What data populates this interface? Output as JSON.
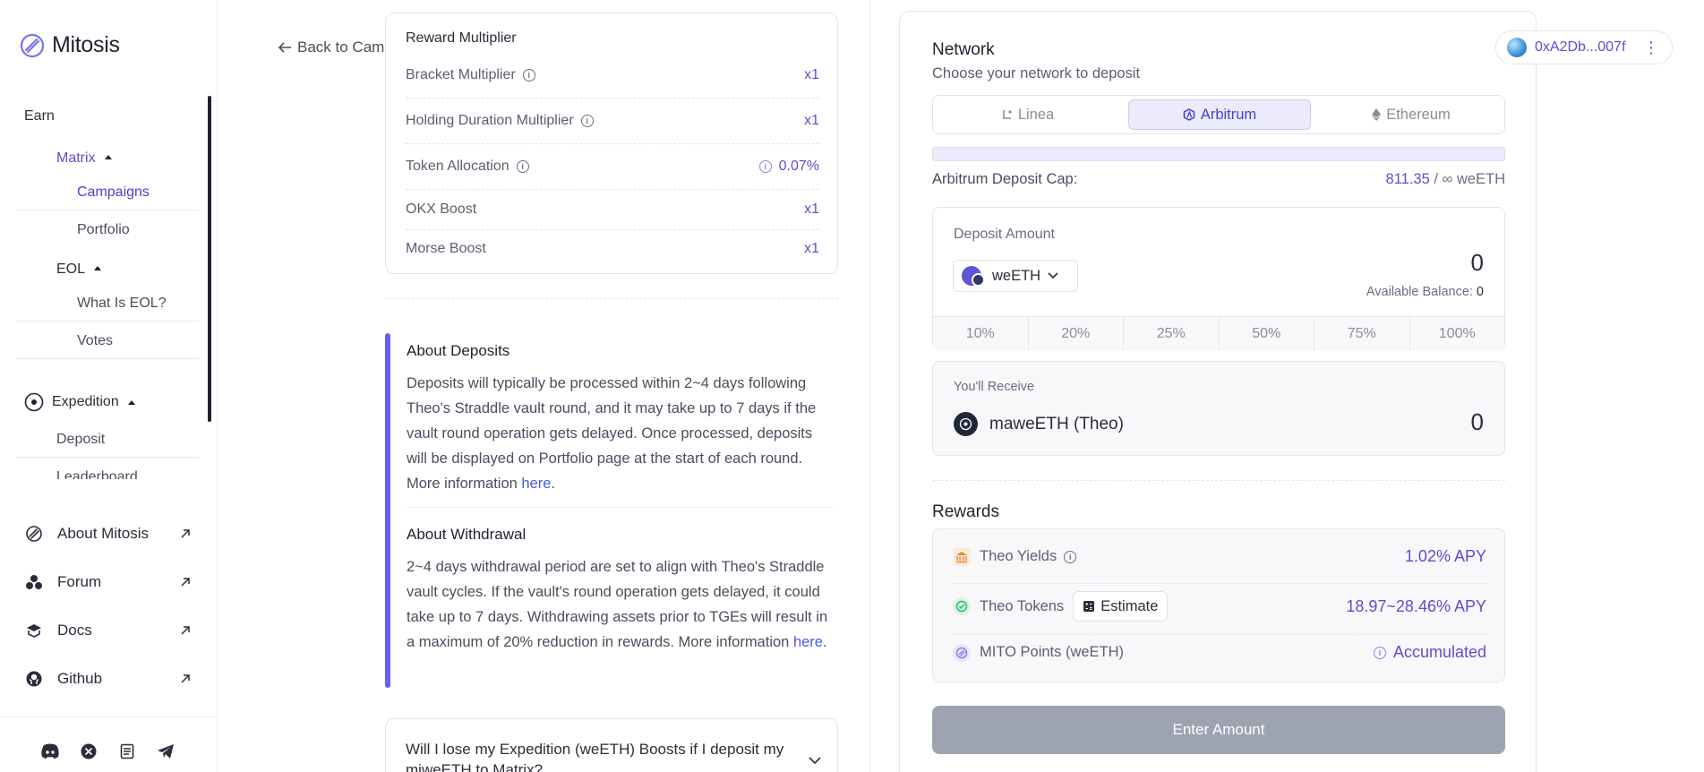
{
  "brand": {
    "name": "Mitosis"
  },
  "sidebar": {
    "earn": "Earn",
    "matrix": "Matrix",
    "campaigns": "Campaigns",
    "portfolio": "Portfolio",
    "eol": "EOL",
    "what_is_eol": "What Is EOL?",
    "votes": "Votes",
    "expedition": "Expedition",
    "deposit": "Deposit",
    "leaderboard": "Leaderboard",
    "external": [
      {
        "label": "About Mitosis",
        "icon": "mitosis-icon"
      },
      {
        "label": "Forum",
        "icon": "forum-icon"
      },
      {
        "label": "Docs",
        "icon": "docs-icon"
      },
      {
        "label": "Github",
        "icon": "github-icon"
      }
    ],
    "social": [
      "discord-icon",
      "x-icon",
      "document-icon",
      "telegram-icon"
    ]
  },
  "back_link": "Back to Campaigns",
  "multipliers": {
    "title": "Reward Multiplier",
    "rows": [
      {
        "label": "Bracket Multiplier",
        "value": "x1",
        "info": true
      },
      {
        "label": "Holding Duration Multiplier",
        "value": "x1",
        "info": true
      },
      {
        "label": "Token Allocation",
        "value": "0.07%",
        "info": true
      },
      {
        "label": "OKX Boost",
        "value": "x1",
        "info": false
      },
      {
        "label": "Morse Boost",
        "value": "x1",
        "info": false
      }
    ]
  },
  "about": {
    "deposits_title": "About Deposits",
    "deposits_text": "Deposits will typically be processed within 2~4 days following Theo's Straddle vault round, and it may take up to 7 days if the vault round operation gets delayed. Once processed, deposits will be displayed on Portfolio page at the start of each round. More information ",
    "withdrawal_title": "About Withdrawal",
    "withdrawal_text": "2~4 days withdrawal period are set to align with Theo's Straddle vault cycles. If the vault's round operation gets delayed, it could take up to 7 days. Withdrawing assets prior to TGEs will result in a maximum of 20% reduction in rewards. More information ",
    "link": "here",
    "period": "."
  },
  "faq": {
    "question": "Will I lose my Expedition (weETH) Boosts if I deposit my miweETH to Matrix?"
  },
  "wallet": {
    "address": "0xA2Db...007f"
  },
  "network": {
    "title": "Network",
    "subtitle": "Choose your network to deposit",
    "tabs": [
      "Linea",
      "Arbitrum",
      "Ethereum"
    ],
    "selected": "Arbitrum",
    "cap_label": "Arbitrum Deposit Cap:",
    "cap_value": "811.35",
    "cap_limit": " / ∞ weETH"
  },
  "deposit": {
    "label": "Deposit Amount",
    "token": "weETH",
    "amount": "0",
    "available_label": "Available Balance:",
    "available_value": "0",
    "percents": [
      "10%",
      "20%",
      "25%",
      "50%",
      "75%",
      "100%"
    ]
  },
  "receive": {
    "label": "You'll Receive",
    "token": "maweETH (Theo)",
    "amount": "0"
  },
  "rewards": {
    "title": "Rewards",
    "rows": [
      {
        "label": "Theo Yields",
        "value": "1.02% APY"
      },
      {
        "label": "Theo Tokens",
        "value": "18.97~28.46% APY",
        "button": "Estimate"
      },
      {
        "label": "MITO Points (weETH)",
        "value": "Accumulated"
      }
    ]
  },
  "enter_button": "Enter Amount",
  "colors": {
    "accent": "#5a4fcf",
    "bar": "#6b5ff0",
    "disabled": "#9ea3b2"
  }
}
